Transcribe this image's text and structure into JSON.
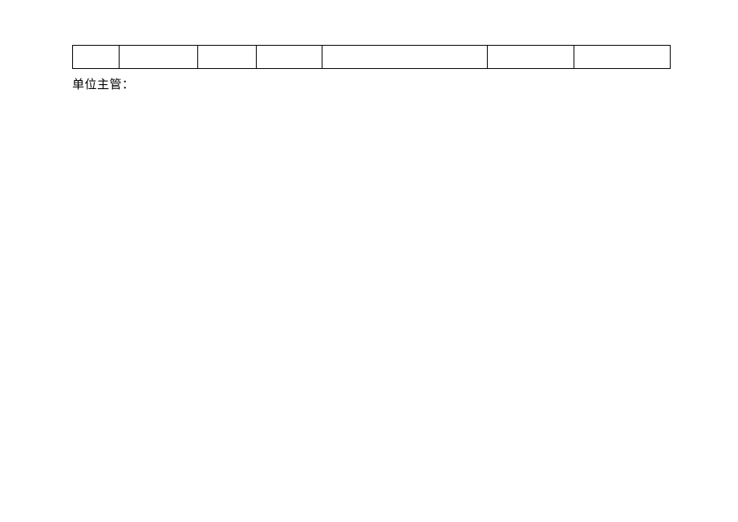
{
  "signature_label": "单位主管：",
  "table": {
    "rows": [
      {
        "cells": [
          "",
          "",
          "",
          "",
          "",
          "",
          ""
        ]
      }
    ]
  }
}
